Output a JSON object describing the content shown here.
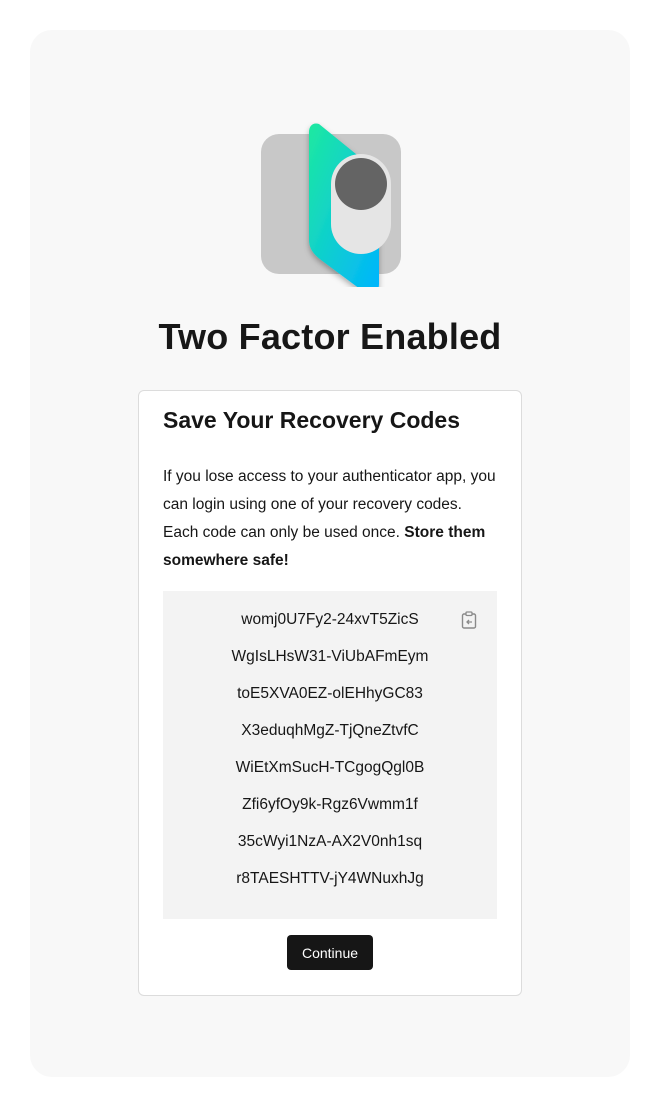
{
  "hero": {
    "icon": "two-factor-toggle-icon"
  },
  "page_title": "Two Factor Enabled",
  "card": {
    "title": "Save Your Recovery Codes",
    "description": "If you lose access to your authenticator app, you can login using one of your recovery codes. Each code can only be used once.",
    "description_emphasis": "Store them somewhere safe!",
    "copy_icon": "clipboard-icon",
    "codes": [
      "womj0U7Fy2-24xvT5ZicS",
      "WgIsLHsW31-ViUbAFmEym",
      "toE5XVA0EZ-olEHhyGC83",
      "X3eduqhMgZ-TjQneZtvfC",
      "WiEtXmSucH-TCgogQgl0B",
      "Zfi6yfOy9k-Rgz6Vwmm1f",
      "35cWyi1NzA-AX2V0nh1sq",
      "r8TAESHTTV-jY4WNuxhJg"
    ],
    "continue_label": "Continue"
  },
  "colors": {
    "background": "#f8f8f8",
    "card": "#ffffff",
    "codes_box": "#f3f3f3",
    "button": "#161616",
    "accent_gradient_start": "#1de9a0",
    "accent_gradient_end": "#00b4ff"
  }
}
